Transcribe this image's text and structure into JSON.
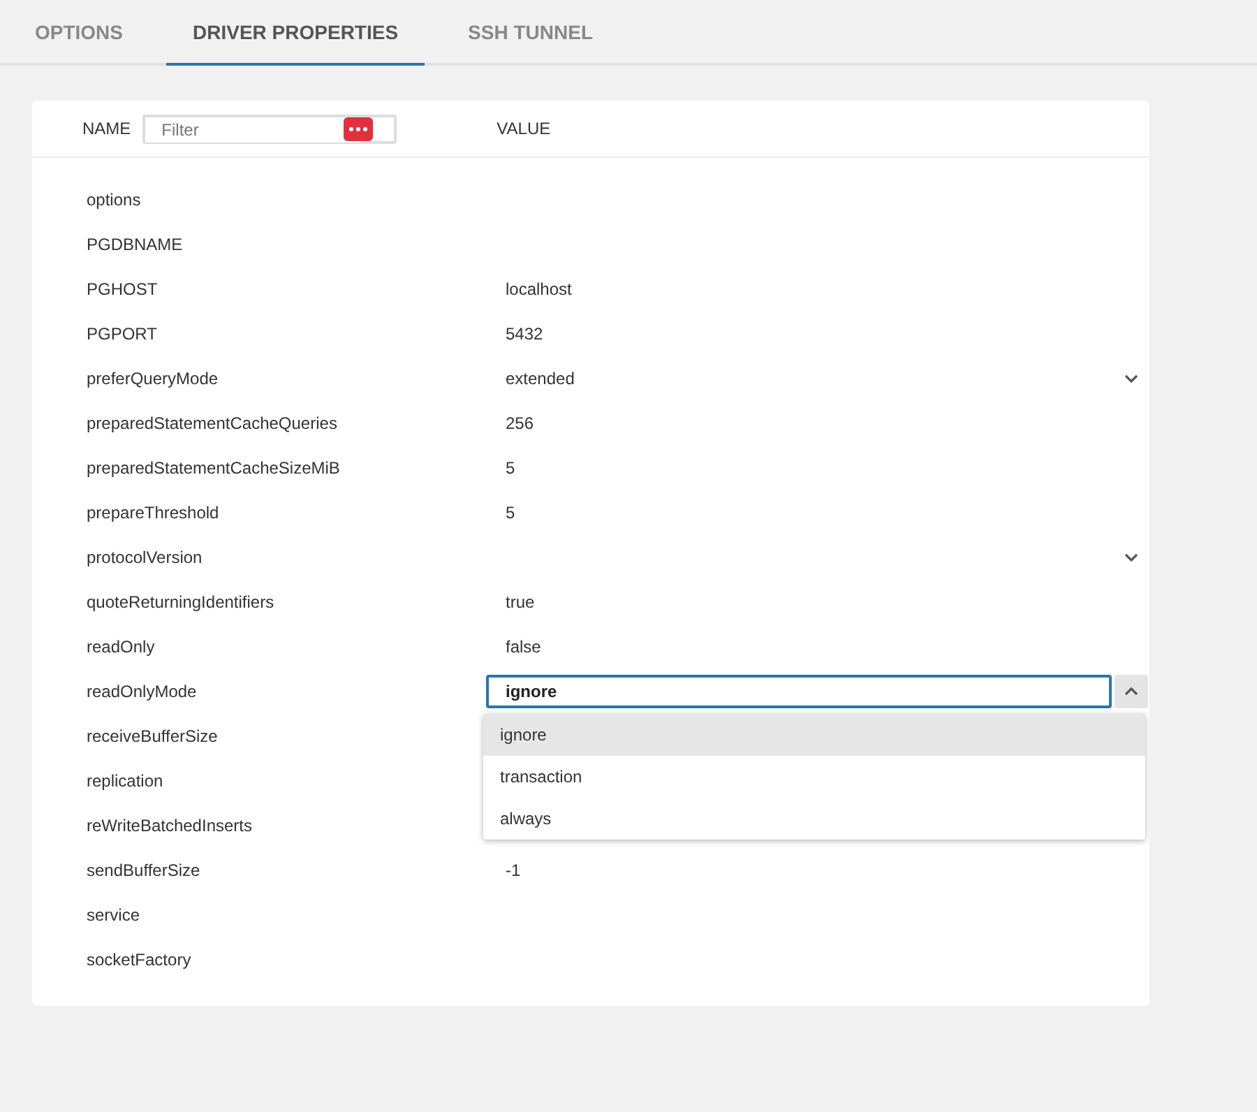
{
  "tabs": [
    {
      "label": "OPTIONS",
      "selected": false
    },
    {
      "label": "DRIVER PROPERTIES",
      "selected": true
    },
    {
      "label": "SSH TUNNEL",
      "selected": false
    }
  ],
  "table": {
    "name_header": "NAME",
    "filter": {
      "placeholder": "Filter"
    },
    "value_header": "VALUE",
    "rows": [
      {
        "name": "options",
        "kind": "text"
      },
      {
        "name": "PGDBNAME",
        "kind": "text"
      },
      {
        "name": "PGHOST",
        "kind": "text",
        "value": "localhost"
      },
      {
        "name": "PGPORT",
        "kind": "text",
        "value": "5432"
      },
      {
        "name": "preferQueryMode",
        "kind": "select",
        "value": "extended"
      },
      {
        "name": "preparedStatementCacheQueries",
        "kind": "text",
        "value": "256"
      },
      {
        "name": "preparedStatementCacheSizeMiB",
        "kind": "text",
        "value": "5"
      },
      {
        "name": "prepareThreshold",
        "kind": "text",
        "value": "5"
      },
      {
        "name": "protocolVersion",
        "kind": "select"
      },
      {
        "name": "quoteReturningIdentifiers",
        "kind": "text",
        "value": "true"
      },
      {
        "name": "readOnly",
        "kind": "text",
        "value": "false"
      },
      {
        "name": "readOnlyMode",
        "kind": "open_select",
        "value": "ignore",
        "options": [
          {
            "label": "ignore",
            "selected": true
          },
          {
            "label": "transaction",
            "selected": false
          },
          {
            "label": "always",
            "selected": false
          }
        ]
      },
      {
        "name": "receiveBufferSize",
        "kind": "text"
      },
      {
        "name": "replication",
        "kind": "text"
      },
      {
        "name": "reWriteBatchedInserts",
        "kind": "text"
      },
      {
        "name": "sendBufferSize",
        "kind": "text",
        "value": "-1"
      },
      {
        "name": "service",
        "kind": "text"
      },
      {
        "name": "socketFactory",
        "kind": "text"
      }
    ]
  }
}
